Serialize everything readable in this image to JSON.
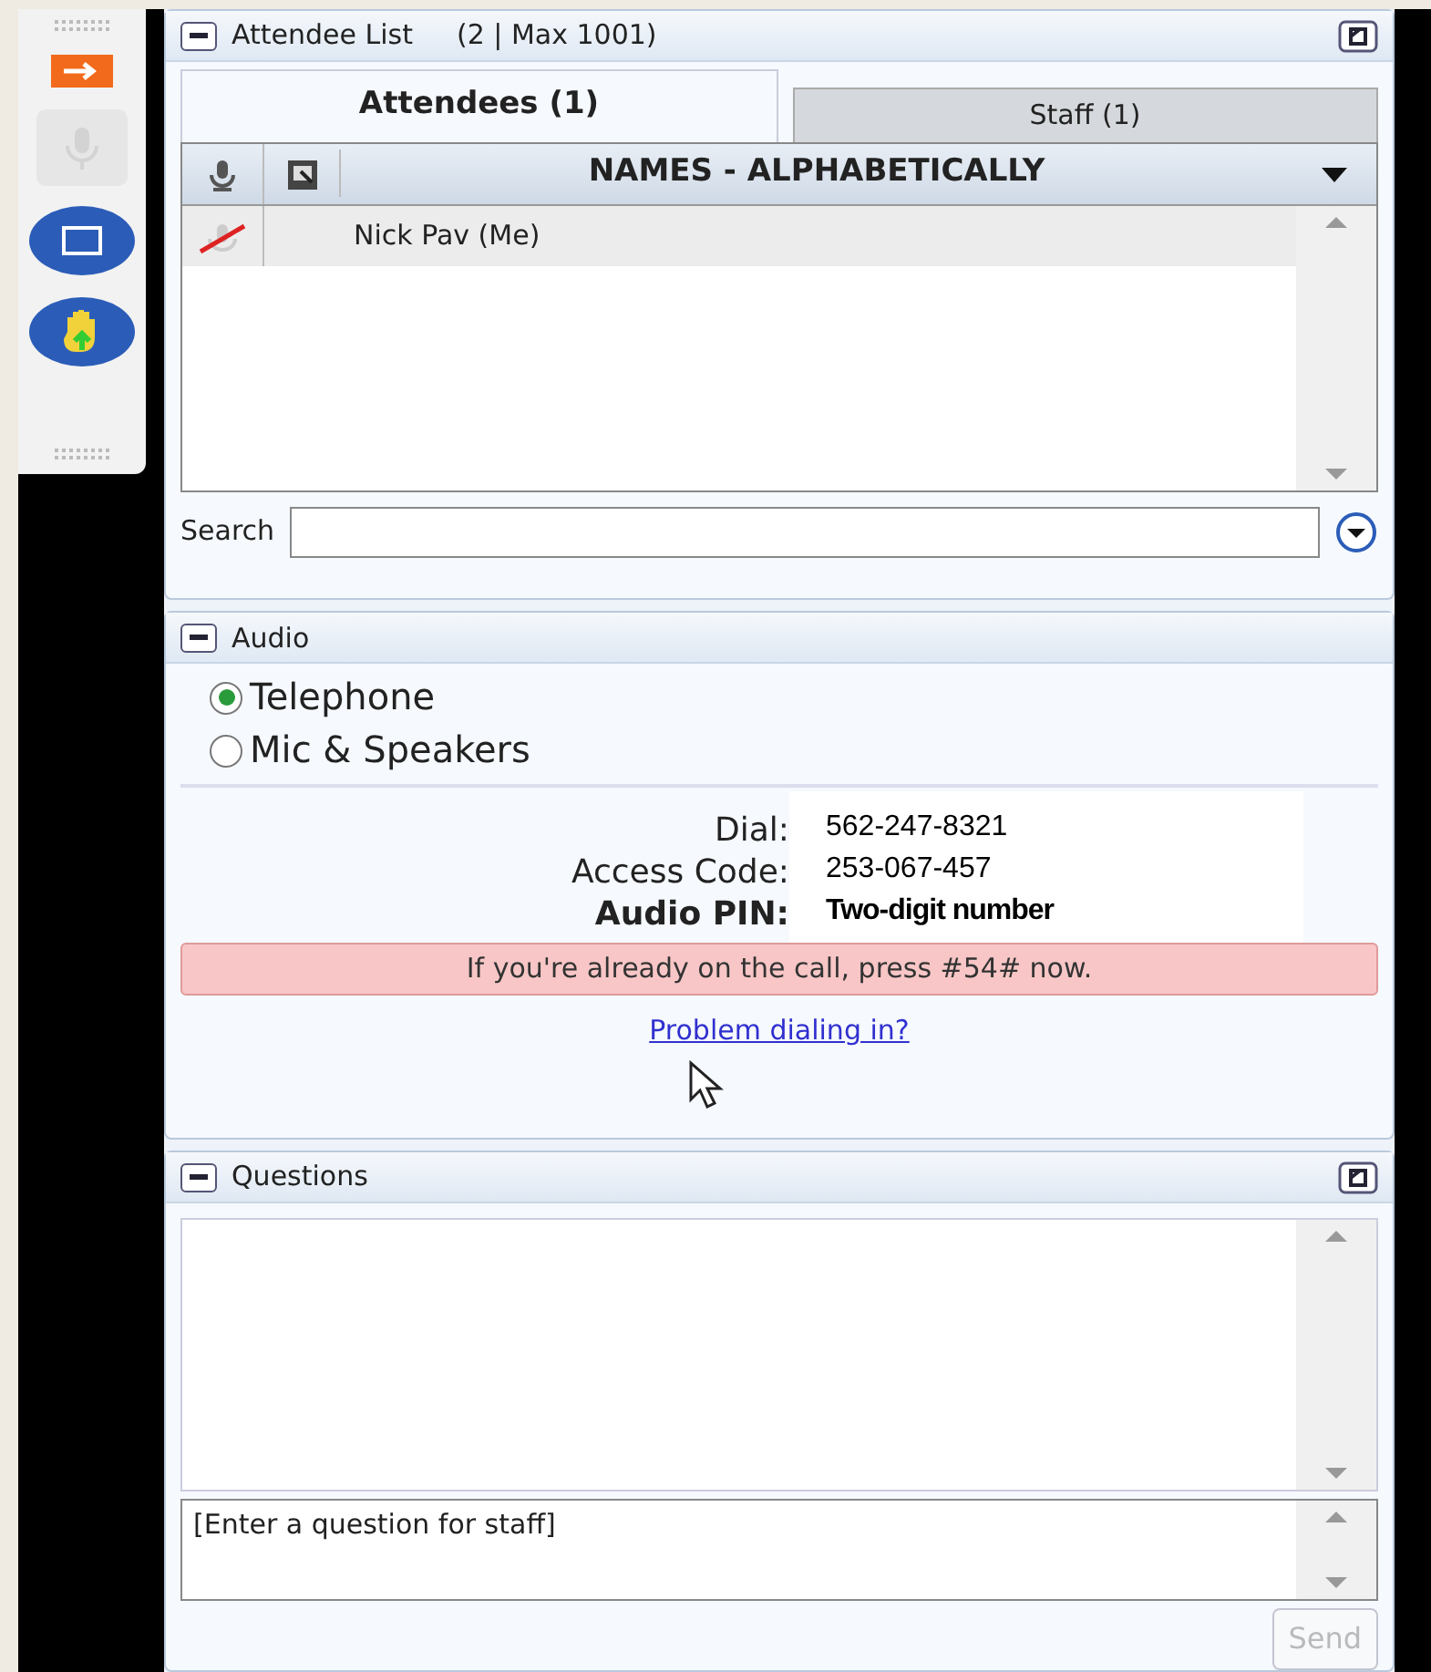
{
  "toolbar": {
    "items": [
      {
        "kind": "arrow",
        "disabled": false
      },
      {
        "kind": "mic",
        "disabled": true
      },
      {
        "kind": "screen",
        "disabled": false
      },
      {
        "kind": "hand",
        "disabled": false
      }
    ]
  },
  "attendee_list": {
    "title": "Attendee List",
    "count": "(2 | Max 1001)",
    "tabs": [
      {
        "label": "Attendees (1)",
        "selected": true
      },
      {
        "label": "Staff (1)",
        "selected": false
      }
    ],
    "columns": {
      "column_3": "NAMES - ALPHABETICALLY"
    },
    "rows": [
      {
        "name": "Nick Pav (Me)",
        "muted": true
      }
    ],
    "search": {
      "label": "Search"
    }
  },
  "audio": {
    "title": "Audio",
    "options": [
      {
        "label": "Telephone",
        "selected": true
      },
      {
        "label": "Mic & Speakers",
        "selected": false
      }
    ],
    "details": [
      {
        "label": "Dial:",
        "value": "562-247-8321",
        "bold": false
      },
      {
        "label": "Access Code:",
        "value": "253-067-457",
        "bold": false
      },
      {
        "label": "Audio PIN:",
        "value": "Two-digit number",
        "bold": true
      }
    ],
    "notice": "If you're already on the call, press #54# now.",
    "link": "Problem dialing in?"
  },
  "questions": {
    "title": "Questions",
    "input": {
      "placeholder": "[Enter a question for staff]"
    },
    "send": {
      "label": "Send",
      "disabled": true
    }
  }
}
